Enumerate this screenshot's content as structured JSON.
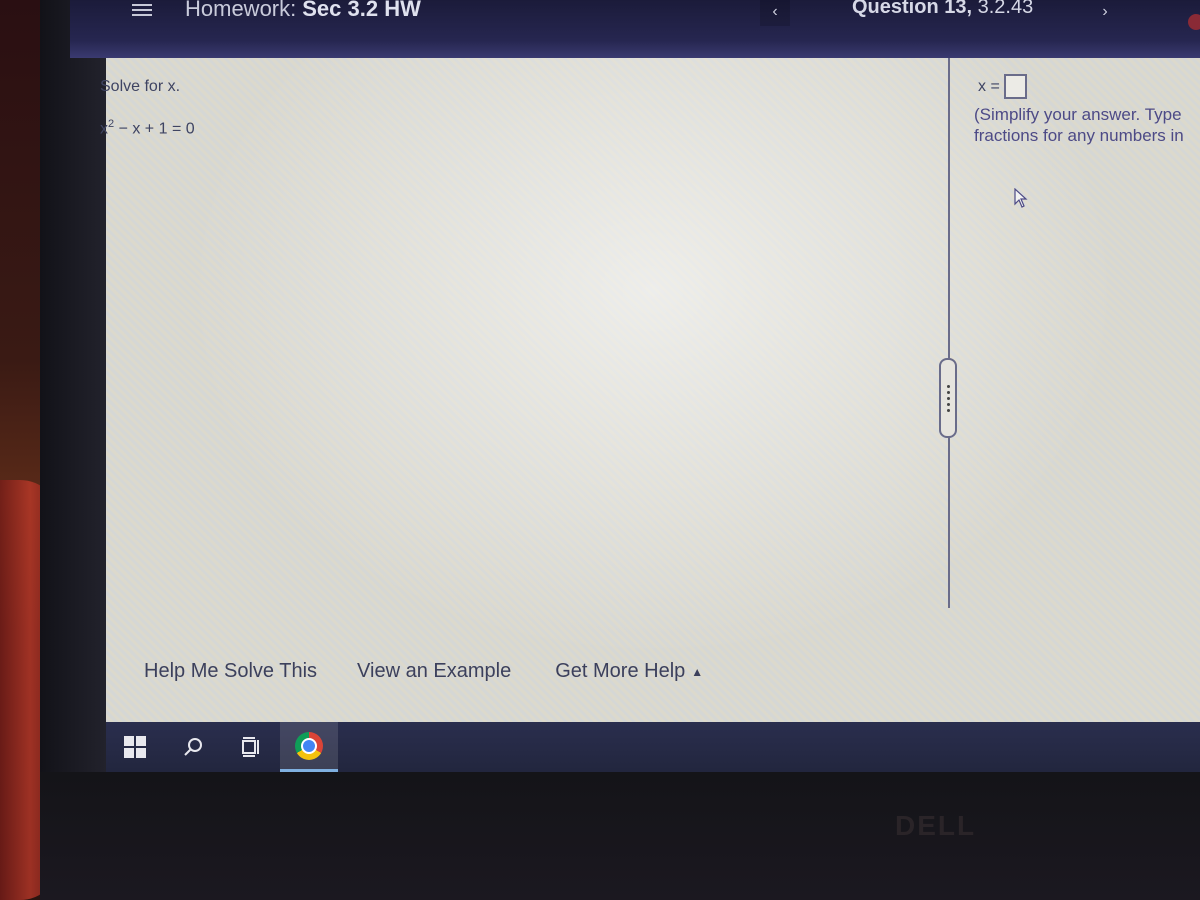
{
  "header": {
    "homework_prefix": "Homework:",
    "homework_name": "Sec 3.2 HW",
    "question_prefix": "Question 13,",
    "question_id": "3.2.43",
    "prev_icon": "chevron-left-icon",
    "next_icon": "chevron-right-icon",
    "prev_glyph": "‹",
    "next_glyph": "›"
  },
  "question": {
    "prompt": "Solve for x.",
    "equation_base": "x",
    "equation_exponent": "2",
    "equation_rest": " − x + 1 = 0"
  },
  "answer": {
    "label": "x =",
    "value": "",
    "instructions_line1": "(Simplify your answer. Type",
    "instructions_line2": "fractions for any numbers in"
  },
  "help": {
    "help_me_solve": "Help Me Solve This",
    "view_example": "View an Example",
    "get_more_help": "Get More Help",
    "caret": "▲"
  },
  "taskbar": {
    "items": [
      "start-icon",
      "search-icon",
      "task-view-icon",
      "chrome-icon"
    ]
  },
  "brand": {
    "logo_text": "DELL"
  }
}
